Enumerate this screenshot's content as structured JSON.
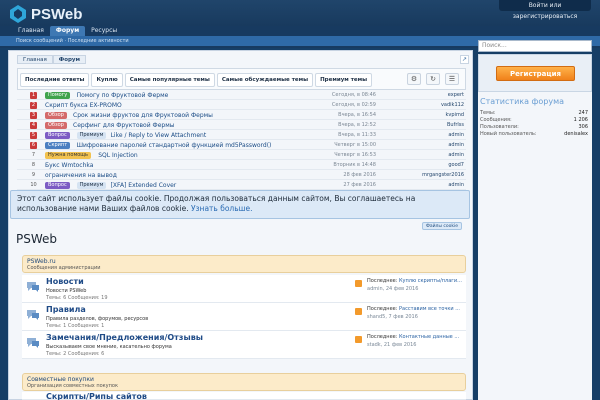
{
  "brand": {
    "name": "PSWeb"
  },
  "header": {
    "login_link": "Войти или зарегистрироваться"
  },
  "nav": {
    "tabs": [
      "Главная",
      "Форум",
      "Ресурсы"
    ],
    "active": 1,
    "sub_links": "Поиск сообщений · Последние активности"
  },
  "breadcrumb": [
    "Главная",
    "Форум"
  ],
  "tabs": [
    "Последние ответы",
    "Куплю",
    "Самые популярные темы",
    "Самые обсуждаемые темы",
    "Премиум темы"
  ],
  "threads": [
    {
      "num": "1",
      "prefix": "Помогу",
      "prefix_color": "#3fa34d",
      "title": "Помогу по Фруктовой Ферме",
      "date": "Сегодня, в 08:46",
      "user": "expert"
    },
    {
      "num": "2",
      "prefix": "",
      "prefix_color": "",
      "title": "Скрипт букса EX-PROMO",
      "date": "Сегодня, в 02:59",
      "user": "vadik112"
    },
    {
      "num": "3",
      "prefix": "Обзор",
      "prefix_color": "#d46a6a",
      "title": "Срок жизни фруктов для Фруктовой Фермы",
      "date": "Вчера, в 16:54",
      "user": "kvpimd"
    },
    {
      "num": "4",
      "prefix": "Обзор",
      "prefix_color": "#d46a6a",
      "title": "Серфинг для Фруктовой Фермы",
      "date": "Вчера, в 12:52",
      "user": "Bufrlss"
    },
    {
      "num": "5",
      "prefix": "Вопрос",
      "prefix_color": "#7c5cc4",
      "premium": "Премиум",
      "title": "Like / Reply to View Attachment",
      "date": "Вчера, в 11:33",
      "user": "admin"
    },
    {
      "num": "6",
      "prefix": "Скрипт",
      "prefix_color": "#4b7fc1",
      "title": "Шифрование паролей стандартной функцией md5Password()",
      "date": "Четверг в 15:00",
      "user": "admin"
    },
    {
      "num": "7",
      "prefix": "Нужна помощь",
      "prefix_color": "#f2c24f",
      "title": "SQL Injection",
      "date": "Четверг в 16:53",
      "user": "admin"
    },
    {
      "num": "8",
      "prefix": "",
      "prefix_color": "",
      "title": "Букс Wmtochka",
      "date": "Вторник в 14:48",
      "user": "good7"
    },
    {
      "num": "9",
      "prefix": "",
      "prefix_color": "",
      "title": "ограничения на вывод",
      "date": "28 фев 2016",
      "user": "mrgangster2016"
    },
    {
      "num": "10",
      "prefix": "Вопрос",
      "prefix_color": "#7c5cc4",
      "premium": "Премиум",
      "title": "[XFA] Extended Cover",
      "date": "27 фев 2016",
      "user": "admin"
    }
  ],
  "cookie": {
    "text": "Этот сайт использует файлы cookie. Продолжая пользоваться данным сайтом, Вы соглашаетесь на использование нами Ваших файлов cookie.",
    "more": "Узнать больше.",
    "button": "Файлы cookie"
  },
  "page_title": "PSWeb",
  "categories": [
    {
      "name": "PSWeb.ru",
      "desc": "Сообщения администрации"
    },
    {
      "name": "Совместные покупки",
      "desc": "Организация совместных покупок"
    }
  ],
  "forums": [
    {
      "name": "Новости",
      "desc": "Новости PSWeb",
      "stats": "Темы: 6 Сообщения: 19",
      "last": "Последнее: ",
      "last_title": "Куплю скрипты/плаги...",
      "last_meta": "admin, 24 фев 2016"
    },
    {
      "name": "Правила",
      "desc": "Правила разделов, форумов, ресурсов",
      "stats": "Темы: 1 Сообщения: 1",
      "last": "Последнее: ",
      "last_title": "Расставим все точки ...",
      "last_meta": "shand5, 7 фев 2016"
    },
    {
      "name": "Замечания/Предложения/Отзывы",
      "desc": "Высказываем свое мнение, касательно форума",
      "stats": "Темы: 2 Сообщения: 6",
      "last": "Последнее: ",
      "last_title": "Контактные данные ...",
      "last_meta": "stadk, 21 фев 2016"
    },
    {
      "name": "Скрипты/Рипы сайтов",
      "desc": "",
      "stats": "",
      "last": "",
      "last_title": "",
      "last_meta": ""
    }
  ],
  "sidebar": {
    "search_placeholder": "Поиск...",
    "register": "Регистрация",
    "stats_title": "Статистика форума",
    "stats": [
      {
        "k": "Темы:",
        "v": "247"
      },
      {
        "k": "Сообщения:",
        "v": "1 206"
      },
      {
        "k": "Пользователи:",
        "v": "306"
      },
      {
        "k": "Новый пользователь:",
        "v": "denisalex"
      }
    ]
  },
  "colors": {
    "accent": "#2f6aa7",
    "header": "#173a60",
    "register": "#f0811a"
  }
}
